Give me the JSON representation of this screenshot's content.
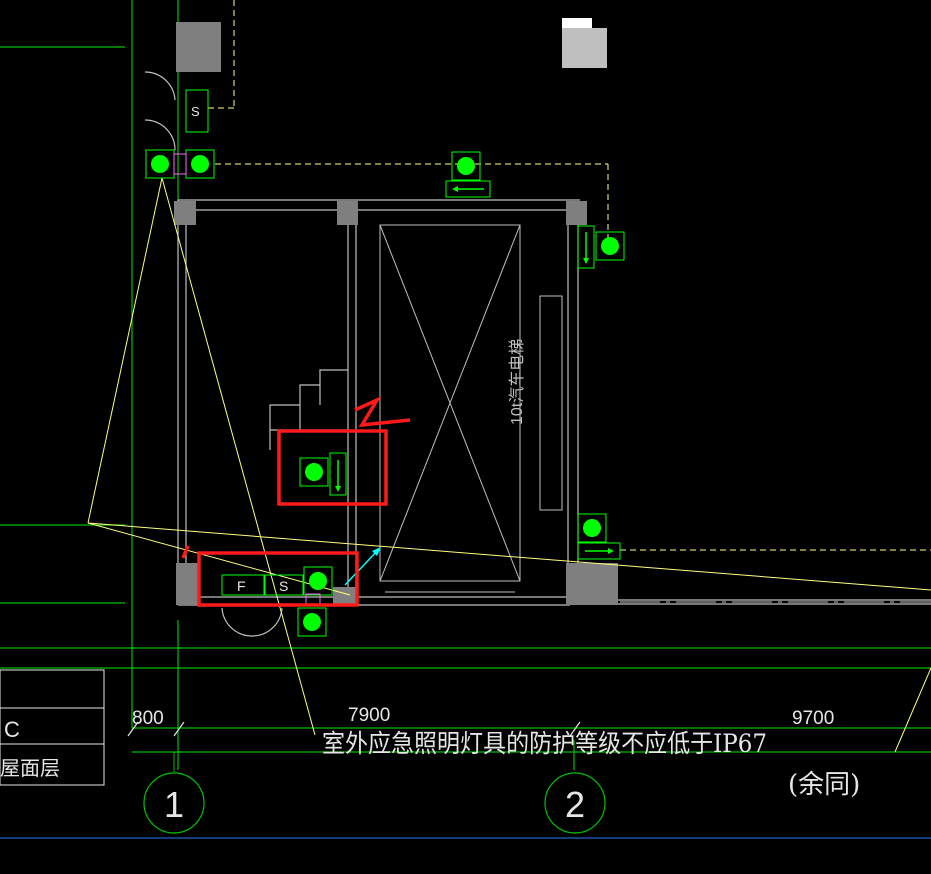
{
  "drawing": {
    "note_text": "室外应急照明灯具的防护等级不应低于IP67",
    "note_sub": "(余同)",
    "elevator_label": "10t汽车电梯",
    "dims": {
      "left": "800",
      "middle": "7900",
      "right": "9700"
    },
    "grid_axes": [
      "1",
      "2"
    ],
    "title_block": {
      "row1": "C",
      "row2": "屋面层"
    },
    "box_labels": {
      "f": "F",
      "s": "S",
      "s_top": "S"
    },
    "annotations": {
      "mark_1": "1",
      "mark_2": "1"
    }
  },
  "colors": {
    "background": "#000000",
    "wall": "#bfbfbf",
    "column": "#7f7f7f",
    "green_line": "#00c000",
    "yellow_line": "#ffff7f",
    "fixture_fill": "#00ff00",
    "red_markup": "#ff1a1a",
    "cyan": "#00ffff",
    "blue_line": "#1e63c8",
    "text_white": "#e6e6e6"
  }
}
